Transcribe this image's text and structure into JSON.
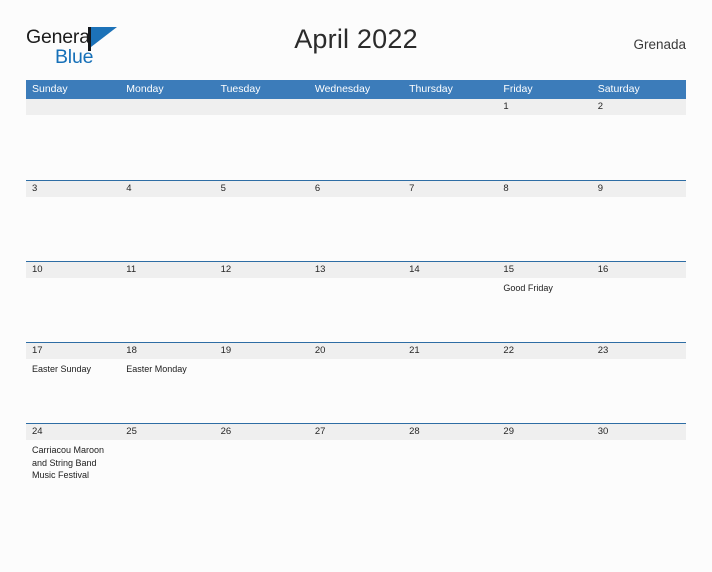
{
  "brand": {
    "name_part1": "General",
    "name_part2": "Blue",
    "flag_icon": "flag-icon",
    "accent_color": "#1c72b8"
  },
  "header": {
    "title": "April 2022",
    "location": "Grenada"
  },
  "theme": {
    "header_bar_color": "#3c7cba",
    "row_border_color": "#2e6da4",
    "day_number_bg": "#efefef",
    "page_bg": "#fcfcfc"
  },
  "calendar": {
    "weekdays": [
      "Sunday",
      "Monday",
      "Tuesday",
      "Wednesday",
      "Thursday",
      "Friday",
      "Saturday"
    ],
    "weeks": [
      [
        {
          "day": "",
          "events": []
        },
        {
          "day": "",
          "events": []
        },
        {
          "day": "",
          "events": []
        },
        {
          "day": "",
          "events": []
        },
        {
          "day": "",
          "events": []
        },
        {
          "day": "1",
          "events": []
        },
        {
          "day": "2",
          "events": []
        }
      ],
      [
        {
          "day": "3",
          "events": []
        },
        {
          "day": "4",
          "events": []
        },
        {
          "day": "5",
          "events": []
        },
        {
          "day": "6",
          "events": []
        },
        {
          "day": "7",
          "events": []
        },
        {
          "day": "8",
          "events": []
        },
        {
          "day": "9",
          "events": []
        }
      ],
      [
        {
          "day": "10",
          "events": []
        },
        {
          "day": "11",
          "events": []
        },
        {
          "day": "12",
          "events": []
        },
        {
          "day": "13",
          "events": []
        },
        {
          "day": "14",
          "events": []
        },
        {
          "day": "15",
          "events": [
            "Good Friday"
          ]
        },
        {
          "day": "16",
          "events": []
        }
      ],
      [
        {
          "day": "17",
          "events": [
            "Easter Sunday"
          ]
        },
        {
          "day": "18",
          "events": [
            "Easter Monday"
          ]
        },
        {
          "day": "19",
          "events": []
        },
        {
          "day": "20",
          "events": []
        },
        {
          "day": "21",
          "events": []
        },
        {
          "day": "22",
          "events": []
        },
        {
          "day": "23",
          "events": []
        }
      ],
      [
        {
          "day": "24",
          "events": [
            "Carriacou Maroon and String Band Music Festival"
          ]
        },
        {
          "day": "25",
          "events": []
        },
        {
          "day": "26",
          "events": []
        },
        {
          "day": "27",
          "events": []
        },
        {
          "day": "28",
          "events": []
        },
        {
          "day": "29",
          "events": []
        },
        {
          "day": "30",
          "events": []
        }
      ]
    ]
  }
}
